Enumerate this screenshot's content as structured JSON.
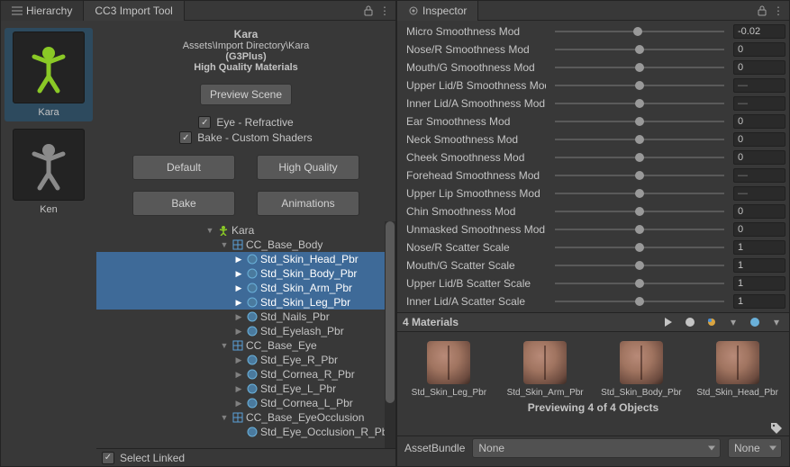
{
  "tabs": {
    "hierarchy": "Hierarchy",
    "cc3": "CC3 Import Tool",
    "inspector": "Inspector"
  },
  "avatars": [
    {
      "name": "Kara",
      "selected": true,
      "color": "#8ac926"
    },
    {
      "name": "Ken",
      "selected": false,
      "color": "#8a8a8a"
    }
  ],
  "character": {
    "name": "Kara",
    "path": "Assets\\Import Directory\\Kara",
    "gen": "(G3Plus)",
    "quality": "High Quality Materials"
  },
  "buttons": {
    "preview": "Preview Scene",
    "default": "Default",
    "highq": "High Quality",
    "bake": "Bake",
    "anim": "Animations"
  },
  "checks": {
    "eye": "Eye - Refractive",
    "bake": "Bake - Custom Shaders"
  },
  "tree": [
    {
      "indent": 0,
      "toggle": "▼",
      "icon": "person",
      "label": "Kara",
      "sel": false
    },
    {
      "indent": 1,
      "toggle": "▼",
      "icon": "mesh",
      "label": "CC_Base_Body",
      "sel": false
    },
    {
      "indent": 2,
      "toggle": "▶",
      "icon": "mat",
      "label": "Std_Skin_Head_Pbr",
      "sel": true
    },
    {
      "indent": 2,
      "toggle": "▶",
      "icon": "mat",
      "label": "Std_Skin_Body_Pbr",
      "sel": true
    },
    {
      "indent": 2,
      "toggle": "▶",
      "icon": "mat",
      "label": "Std_Skin_Arm_Pbr",
      "sel": true
    },
    {
      "indent": 2,
      "toggle": "▶",
      "icon": "mat",
      "label": "Std_Skin_Leg_Pbr",
      "sel": true
    },
    {
      "indent": 2,
      "toggle": "▶",
      "icon": "mat",
      "label": "Std_Nails_Pbr",
      "sel": false
    },
    {
      "indent": 2,
      "toggle": "▶",
      "icon": "mat",
      "label": "Std_Eyelash_Pbr",
      "sel": false
    },
    {
      "indent": 1,
      "toggle": "▼",
      "icon": "mesh",
      "label": "CC_Base_Eye",
      "sel": false
    },
    {
      "indent": 2,
      "toggle": "▶",
      "icon": "mat",
      "label": "Std_Eye_R_Pbr",
      "sel": false
    },
    {
      "indent": 2,
      "toggle": "▶",
      "icon": "mat",
      "label": "Std_Cornea_R_Pbr",
      "sel": false
    },
    {
      "indent": 2,
      "toggle": "▶",
      "icon": "mat",
      "label": "Std_Eye_L_Pbr",
      "sel": false
    },
    {
      "indent": 2,
      "toggle": "▶",
      "icon": "mat",
      "label": "Std_Cornea_L_Pbr",
      "sel": false
    },
    {
      "indent": 1,
      "toggle": "▼",
      "icon": "mesh",
      "label": "CC_Base_EyeOcclusion",
      "sel": false
    },
    {
      "indent": 2,
      "toggle": "",
      "icon": "mat",
      "label": "Std_Eye_Occlusion_R_Pbr",
      "sel": false
    }
  ],
  "bottomBar": {
    "selectLinked": "Select Linked"
  },
  "props": [
    {
      "label": "Micro Smoothness Mod",
      "pos": 49,
      "val": "-0.02"
    },
    {
      "label": "Nose/R Smoothness Mod",
      "pos": 50,
      "val": "0"
    },
    {
      "label": "Mouth/G Smoothness Mod",
      "pos": 50,
      "val": "0"
    },
    {
      "label": "Upper Lid/B Smoothness Mod",
      "pos": 50,
      "val": "—"
    },
    {
      "label": "Inner Lid/A Smoothness Mod",
      "pos": 50,
      "val": "—"
    },
    {
      "label": "Ear Smoothness Mod",
      "pos": 50,
      "val": "0"
    },
    {
      "label": "Neck Smoothness Mod",
      "pos": 50,
      "val": "0"
    },
    {
      "label": "Cheek Smoothness Mod",
      "pos": 50,
      "val": "0"
    },
    {
      "label": "Forehead Smoothness Mod",
      "pos": 50,
      "val": "—"
    },
    {
      "label": "Upper Lip Smoothness Mod",
      "pos": 50,
      "val": "—"
    },
    {
      "label": "Chin Smoothness Mod",
      "pos": 50,
      "val": "0"
    },
    {
      "label": "Unmasked Smoothness Mod",
      "pos": 50,
      "val": "0"
    },
    {
      "label": "Nose/R Scatter Scale",
      "pos": 50,
      "val": "1"
    },
    {
      "label": "Mouth/G Scatter Scale",
      "pos": 50,
      "val": "1"
    },
    {
      "label": "Upper Lid/B Scatter Scale",
      "pos": 50,
      "val": "1"
    },
    {
      "label": "Inner Lid/A Scatter Scale",
      "pos": 50,
      "val": "1"
    }
  ],
  "materialsHeader": "4 Materials",
  "materials": [
    {
      "name": "Std_Skin_Leg_Pbr"
    },
    {
      "name": "Std_Skin_Arm_Pbr"
    },
    {
      "name": "Std_Skin_Body_Pbr"
    },
    {
      "name": "Std_Skin_Head_Pbr"
    }
  ],
  "previewCaption": "Previewing 4 of 4 Objects",
  "assetBundle": {
    "label": "AssetBundle",
    "main": "None",
    "variant": "None"
  }
}
